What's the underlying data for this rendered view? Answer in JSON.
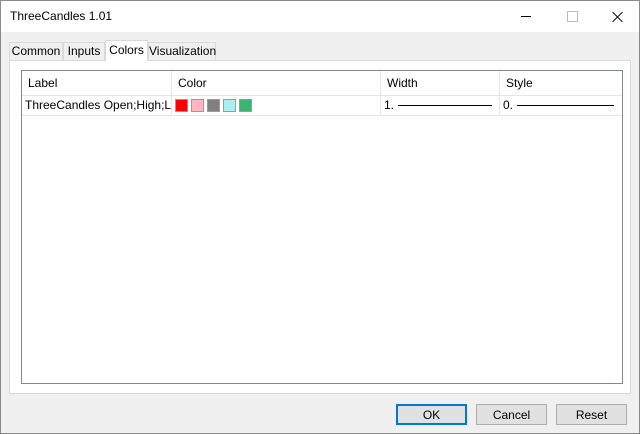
{
  "window": {
    "title": "ThreeCandles 1.01"
  },
  "tabs": [
    {
      "label": "Common"
    },
    {
      "label": "Inputs"
    },
    {
      "label": "Colors"
    },
    {
      "label": "Visualization"
    }
  ],
  "active_tab": "Colors",
  "table": {
    "headers": [
      "Label",
      "Color",
      "Width",
      "Style"
    ],
    "rows": [
      {
        "label": "ThreeCandles Open;High;L...",
        "colors": [
          "#ff0000",
          "#ffb6c1",
          "#808080",
          "#afeeee",
          "#3cb371"
        ],
        "width": "1.",
        "style": "0."
      }
    ]
  },
  "buttons": {
    "ok": "OK",
    "cancel": "Cancel",
    "reset": "Reset"
  }
}
